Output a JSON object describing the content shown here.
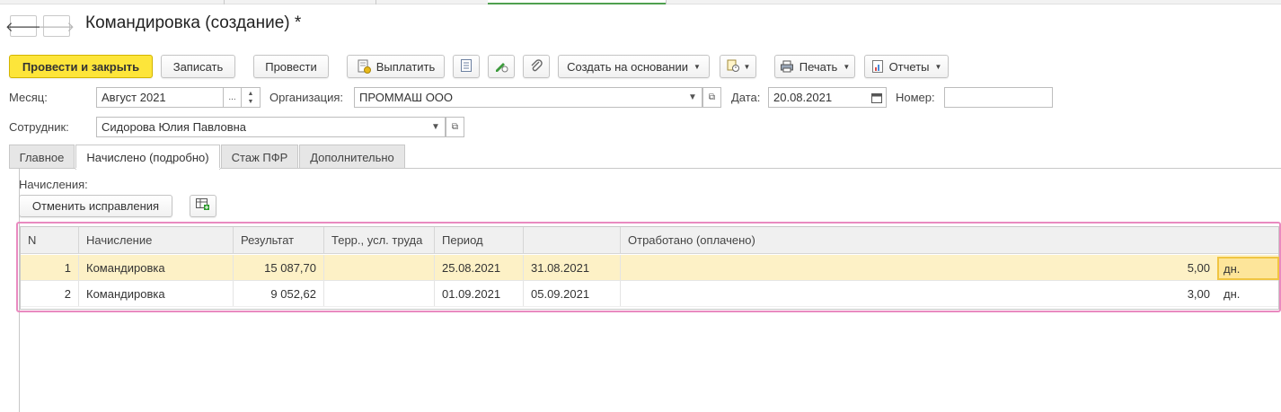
{
  "window": {
    "title": "Командировка (создание) *"
  },
  "toolbar": {
    "post_close": "Провести и закрыть",
    "save": "Записать",
    "post": "Провести",
    "pay": "Выплатить",
    "create_based": "Создать на основании",
    "print": "Печать",
    "reports": "Отчеты"
  },
  "form": {
    "month_label": "Месяц:",
    "month_value": "Август 2021",
    "org_label": "Организация:",
    "org_value": "ПРОММАШ ООО",
    "date_label": "Дата:",
    "date_value": "20.08.2021",
    "number_label": "Номер:",
    "number_value": "",
    "employee_label": "Сотрудник:",
    "employee_value": "Сидорова Юлия Павловна"
  },
  "tabs": [
    {
      "label": "Главное"
    },
    {
      "label": "Начислено (подробно)"
    },
    {
      "label": "Стаж ПФР"
    },
    {
      "label": "Дополнительно"
    }
  ],
  "accruals": {
    "section_label": "Начисления:",
    "cancel_corrections": "Отменить исправления",
    "columns": [
      "N",
      "Начисление",
      "Результат",
      "Терр., усл. труда",
      "Период",
      "",
      "Отработано (оплачено)"
    ],
    "rows": [
      {
        "n": "1",
        "accrual": "Командировка",
        "result": "15 087,70",
        "terr": "",
        "from": "25.08.2021",
        "to": "31.08.2021",
        "worked": "5,00",
        "unit": "дн."
      },
      {
        "n": "2",
        "accrual": "Командировка",
        "result": "9 052,62",
        "terr": "",
        "from": "01.09.2021",
        "to": "05.09.2021",
        "worked": "3,00",
        "unit": "дн."
      }
    ]
  },
  "colors": {
    "primary_button": "#fde53a",
    "selected_row": "#fdf1c6",
    "highlight_frame": "#e98ac0"
  }
}
